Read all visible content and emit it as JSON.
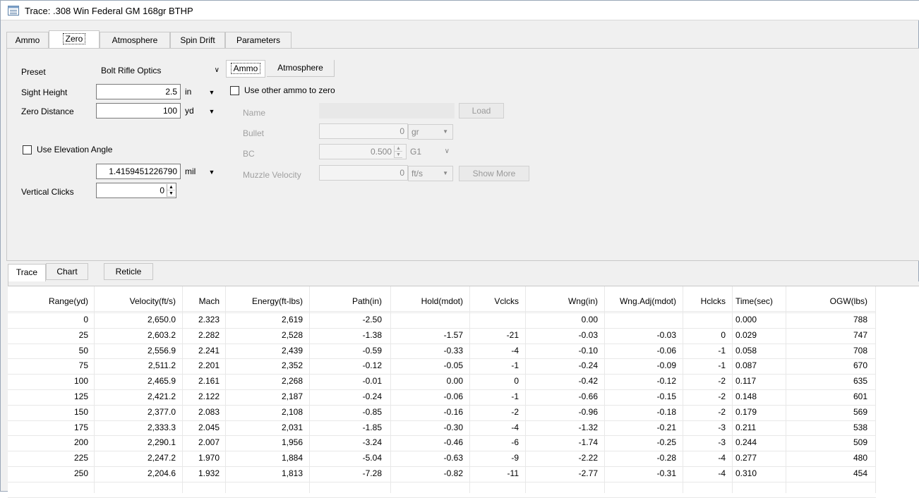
{
  "window": {
    "title": "Trace: .308 Win Federal GM 168gr BTHP"
  },
  "top_tabs": [
    {
      "label": "Ammo",
      "active": false
    },
    {
      "label": "Zero",
      "active": true
    },
    {
      "label": "Atmosphere",
      "active": false
    },
    {
      "label": "Spin Drift",
      "active": false
    },
    {
      "label": "Parameters",
      "active": false
    }
  ],
  "zero": {
    "preset_label": "Preset",
    "preset_value": "Bolt Rifle Optics",
    "sight_height_label": "Sight Height",
    "sight_height_value": "2.5",
    "sight_height_unit": "in",
    "zero_distance_label": "Zero Distance",
    "zero_distance_value": "100",
    "zero_distance_unit": "yd",
    "use_elevation_label": "Use Elevation Angle",
    "elevation_value": "1.4159451226790",
    "elevation_unit": "mil",
    "vertical_clicks_label": "Vertical Clicks",
    "vertical_clicks_value": "0"
  },
  "sub_tabs": [
    {
      "label": "Ammo",
      "active": true
    },
    {
      "label": "Atmosphere",
      "active": false
    }
  ],
  "other_ammo": {
    "use_other_label": "Use other ammo to zero",
    "name_label": "Name",
    "name_value": "",
    "load_button": "Load",
    "bullet_label": "Bullet",
    "bullet_value": "0",
    "bullet_unit": "gr",
    "bc_label": "BC",
    "bc_value": "0.500",
    "bc_model": "G1",
    "mv_label": "Muzzle Velocity",
    "mv_value": "0",
    "mv_unit": "ft/s",
    "show_more_button": "Show More"
  },
  "bottom_tabs": [
    {
      "label": "Trace",
      "active": true
    },
    {
      "label": "Chart",
      "active": false
    },
    {
      "label": "Reticle",
      "active": false
    }
  ],
  "table": {
    "headers": [
      "Range(yd)",
      "Velocity(ft/s)",
      "Mach",
      "Energy(ft-lbs)",
      "Path(in)",
      "Hold(mdot)",
      "Vclcks",
      "Wng(in)",
      "Wng.Adj(mdot)",
      "Hclcks",
      "Time(sec)",
      "OGW(lbs)"
    ],
    "rows": [
      [
        "0",
        "2,650.0",
        "2.323",
        "2,619",
        "-2.50",
        "",
        "",
        "0.00",
        "",
        "",
        "0.000",
        "788"
      ],
      [
        "25",
        "2,603.2",
        "2.282",
        "2,528",
        "-1.38",
        "-1.57",
        "-21",
        "-0.03",
        "-0.03",
        "0",
        "0.029",
        "747"
      ],
      [
        "50",
        "2,556.9",
        "2.241",
        "2,439",
        "-0.59",
        "-0.33",
        "-4",
        "-0.10",
        "-0.06",
        "-1",
        "0.058",
        "708"
      ],
      [
        "75",
        "2,511.2",
        "2.201",
        "2,352",
        "-0.12",
        "-0.05",
        "-1",
        "-0.24",
        "-0.09",
        "-1",
        "0.087",
        "670"
      ],
      [
        "100",
        "2,465.9",
        "2.161",
        "2,268",
        "-0.01",
        "0.00",
        "0",
        "-0.42",
        "-0.12",
        "-2",
        "0.117",
        "635"
      ],
      [
        "125",
        "2,421.2",
        "2.122",
        "2,187",
        "-0.24",
        "-0.06",
        "-1",
        "-0.66",
        "-0.15",
        "-2",
        "0.148",
        "601"
      ],
      [
        "150",
        "2,377.0",
        "2.083",
        "2,108",
        "-0.85",
        "-0.16",
        "-2",
        "-0.96",
        "-0.18",
        "-2",
        "0.179",
        "569"
      ],
      [
        "175",
        "2,333.3",
        "2.045",
        "2,031",
        "-1.85",
        "-0.30",
        "-4",
        "-1.32",
        "-0.21",
        "-3",
        "0.211",
        "538"
      ],
      [
        "200",
        "2,290.1",
        "2.007",
        "1,956",
        "-3.24",
        "-0.46",
        "-6",
        "-1.74",
        "-0.25",
        "-3",
        "0.244",
        "509"
      ],
      [
        "225",
        "2,247.2",
        "1.970",
        "1,884",
        "-5.04",
        "-0.63",
        "-9",
        "-2.22",
        "-0.28",
        "-4",
        "0.277",
        "480"
      ],
      [
        "250",
        "2,204.6",
        "1.932",
        "1,813",
        "-7.28",
        "-0.82",
        "-11",
        "-2.77",
        "-0.31",
        "-4",
        "0.310",
        "454"
      ]
    ]
  }
}
